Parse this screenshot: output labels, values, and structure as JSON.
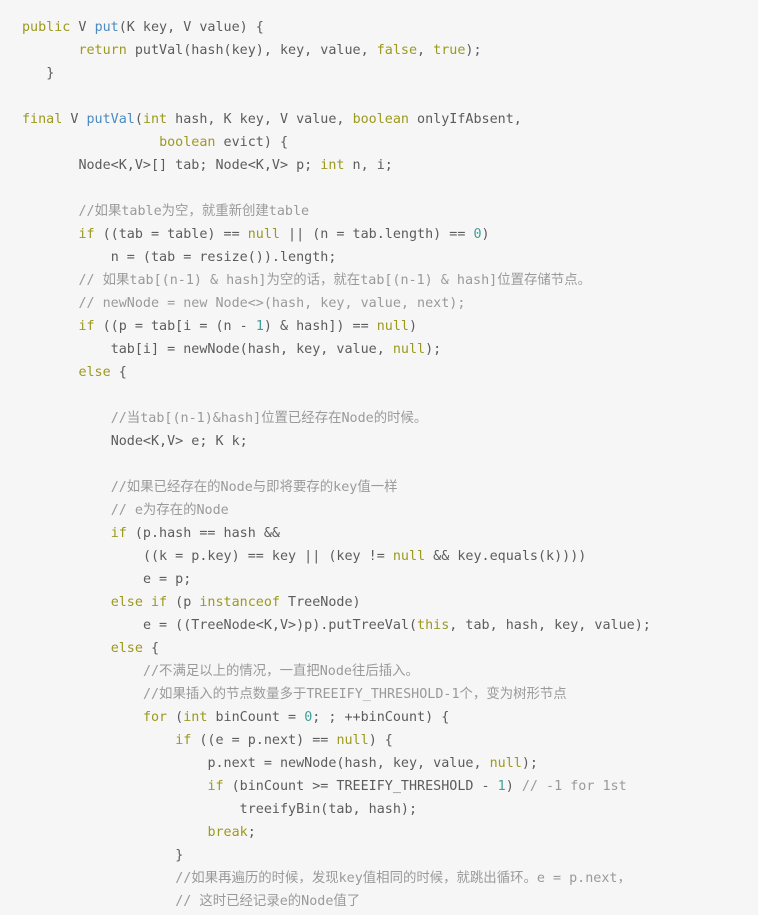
{
  "code": {
    "language": "java",
    "colors": {
      "background": "#f6f6f6",
      "text": "#5c5c5c",
      "keyword": "#9c9a1e",
      "function": "#4b8ac2",
      "number": "#3f9e9a",
      "comment": "#9a9a9a"
    },
    "lines": [
      {
        "indent": 0,
        "tokens": [
          [
            "kw",
            "public"
          ],
          [
            "t",
            " V "
          ],
          [
            "fn",
            "put"
          ],
          [
            "t",
            "(K key, V value) {"
          ]
        ]
      },
      {
        "indent": 7,
        "tokens": [
          [
            "kw",
            "return"
          ],
          [
            "t",
            " putVal(hash(key), key, value, "
          ],
          [
            "kw",
            "false"
          ],
          [
            "t",
            ", "
          ],
          [
            "kw",
            "true"
          ],
          [
            "t",
            ");"
          ]
        ]
      },
      {
        "indent": 3,
        "tokens": [
          [
            "t",
            "}"
          ]
        ]
      },
      {
        "indent": 0,
        "tokens": []
      },
      {
        "indent": 0,
        "tokens": [
          [
            "kw",
            "final"
          ],
          [
            "t",
            " V "
          ],
          [
            "fn",
            "putVal"
          ],
          [
            "t",
            "("
          ],
          [
            "kw",
            "int"
          ],
          [
            "t",
            " hash, K key, V value, "
          ],
          [
            "kw",
            "boolean"
          ],
          [
            "t",
            " onlyIfAbsent,"
          ]
        ]
      },
      {
        "indent": 17,
        "tokens": [
          [
            "kw",
            "boolean"
          ],
          [
            "t",
            " evict) {"
          ]
        ]
      },
      {
        "indent": 7,
        "tokens": [
          [
            "t",
            "Node<K,V>[] tab; Node<K,V> p; "
          ],
          [
            "kw",
            "int"
          ],
          [
            "t",
            " n, i;"
          ]
        ]
      },
      {
        "indent": 0,
        "tokens": []
      },
      {
        "indent": 7,
        "tokens": [
          [
            "cm",
            "//如果table为空，就重新创建table"
          ]
        ]
      },
      {
        "indent": 7,
        "tokens": [
          [
            "kw",
            "if"
          ],
          [
            "t",
            " ((tab = table) == "
          ],
          [
            "kw",
            "null"
          ],
          [
            "t",
            " || (n = tab.length) == "
          ],
          [
            "num",
            "0"
          ],
          [
            "t",
            ")"
          ]
        ]
      },
      {
        "indent": 11,
        "tokens": [
          [
            "t",
            "n = (tab = resize()).length;"
          ]
        ]
      },
      {
        "indent": 7,
        "tokens": [
          [
            "cm",
            "// 如果tab[(n-1) & hash]为空的话，就在tab[(n-1) & hash]位置存储节点。"
          ]
        ]
      },
      {
        "indent": 7,
        "tokens": [
          [
            "cm",
            "// newNode = new Node<>(hash, key, value, next);"
          ]
        ]
      },
      {
        "indent": 7,
        "tokens": [
          [
            "kw",
            "if"
          ],
          [
            "t",
            " ((p = tab[i = (n - "
          ],
          [
            "num",
            "1"
          ],
          [
            "t",
            ") & hash]) == "
          ],
          [
            "kw",
            "null"
          ],
          [
            "t",
            ")"
          ]
        ]
      },
      {
        "indent": 11,
        "tokens": [
          [
            "t",
            "tab[i] = newNode(hash, key, value, "
          ],
          [
            "kw",
            "null"
          ],
          [
            "t",
            ");"
          ]
        ]
      },
      {
        "indent": 7,
        "tokens": [
          [
            "kw",
            "else"
          ],
          [
            "t",
            " {"
          ]
        ]
      },
      {
        "indent": 0,
        "tokens": []
      },
      {
        "indent": 11,
        "tokens": [
          [
            "cm",
            "//当tab[(n-1)&hash]位置已经存在Node的时候。"
          ]
        ]
      },
      {
        "indent": 11,
        "tokens": [
          [
            "t",
            "Node<K,V> e; K k;"
          ]
        ]
      },
      {
        "indent": 0,
        "tokens": []
      },
      {
        "indent": 11,
        "tokens": [
          [
            "cm",
            "//如果已经存在的Node与即将要存的key值一样"
          ]
        ]
      },
      {
        "indent": 11,
        "tokens": [
          [
            "cm",
            "// e为存在的Node"
          ]
        ]
      },
      {
        "indent": 11,
        "tokens": [
          [
            "kw",
            "if"
          ],
          [
            "t",
            " (p.hash == hash &&"
          ]
        ]
      },
      {
        "indent": 15,
        "tokens": [
          [
            "t",
            "((k = p.key) == key || (key != "
          ],
          [
            "kw",
            "null"
          ],
          [
            "t",
            " && key.equals(k))))"
          ]
        ]
      },
      {
        "indent": 15,
        "tokens": [
          [
            "t",
            "e = p;"
          ]
        ]
      },
      {
        "indent": 11,
        "tokens": [
          [
            "kw",
            "else"
          ],
          [
            "t",
            " "
          ],
          [
            "kw",
            "if"
          ],
          [
            "t",
            " (p "
          ],
          [
            "kw",
            "instanceof"
          ],
          [
            "t",
            " TreeNode)"
          ]
        ]
      },
      {
        "indent": 15,
        "tokens": [
          [
            "t",
            "e = ((TreeNode<K,V>)p).putTreeVal("
          ],
          [
            "kw",
            "this"
          ],
          [
            "t",
            ", tab, hash, key, value);"
          ]
        ]
      },
      {
        "indent": 11,
        "tokens": [
          [
            "kw",
            "else"
          ],
          [
            "t",
            " {"
          ]
        ]
      },
      {
        "indent": 15,
        "tokens": [
          [
            "cm",
            "//不满足以上的情况，一直把Node往后插入。"
          ]
        ]
      },
      {
        "indent": 15,
        "tokens": [
          [
            "cm",
            "//如果插入的节点数量多于TREEIFY_THRESHOLD-1个，变为树形节点"
          ]
        ]
      },
      {
        "indent": 15,
        "tokens": [
          [
            "kw",
            "for"
          ],
          [
            "t",
            " ("
          ],
          [
            "kw",
            "int"
          ],
          [
            "t",
            " binCount = "
          ],
          [
            "num",
            "0"
          ],
          [
            "t",
            "; ; ++binCount) {"
          ]
        ]
      },
      {
        "indent": 19,
        "tokens": [
          [
            "kw",
            "if"
          ],
          [
            "t",
            " ((e = p.next) == "
          ],
          [
            "kw",
            "null"
          ],
          [
            "t",
            ") {"
          ]
        ]
      },
      {
        "indent": 23,
        "tokens": [
          [
            "t",
            "p.next = newNode(hash, key, value, "
          ],
          [
            "kw",
            "null"
          ],
          [
            "t",
            ");"
          ]
        ]
      },
      {
        "indent": 23,
        "tokens": [
          [
            "kw",
            "if"
          ],
          [
            "t",
            " (binCount >= TREEIFY_THRESHOLD - "
          ],
          [
            "num",
            "1"
          ],
          [
            "t",
            ") "
          ],
          [
            "cm",
            "// -1 for 1st"
          ]
        ]
      },
      {
        "indent": 27,
        "tokens": [
          [
            "t",
            "treeifyBin(tab, hash);"
          ]
        ]
      },
      {
        "indent": 23,
        "tokens": [
          [
            "kw",
            "break"
          ],
          [
            "t",
            ";"
          ]
        ]
      },
      {
        "indent": 19,
        "tokens": [
          [
            "t",
            "}"
          ]
        ]
      },
      {
        "indent": 19,
        "tokens": [
          [
            "cm",
            "//如果再遍历的时候，发现key值相同的时候，就跳出循环。e = p.next，"
          ]
        ]
      },
      {
        "indent": 19,
        "tokens": [
          [
            "cm",
            "// 这时已经记录e的Node值了"
          ]
        ]
      }
    ]
  }
}
